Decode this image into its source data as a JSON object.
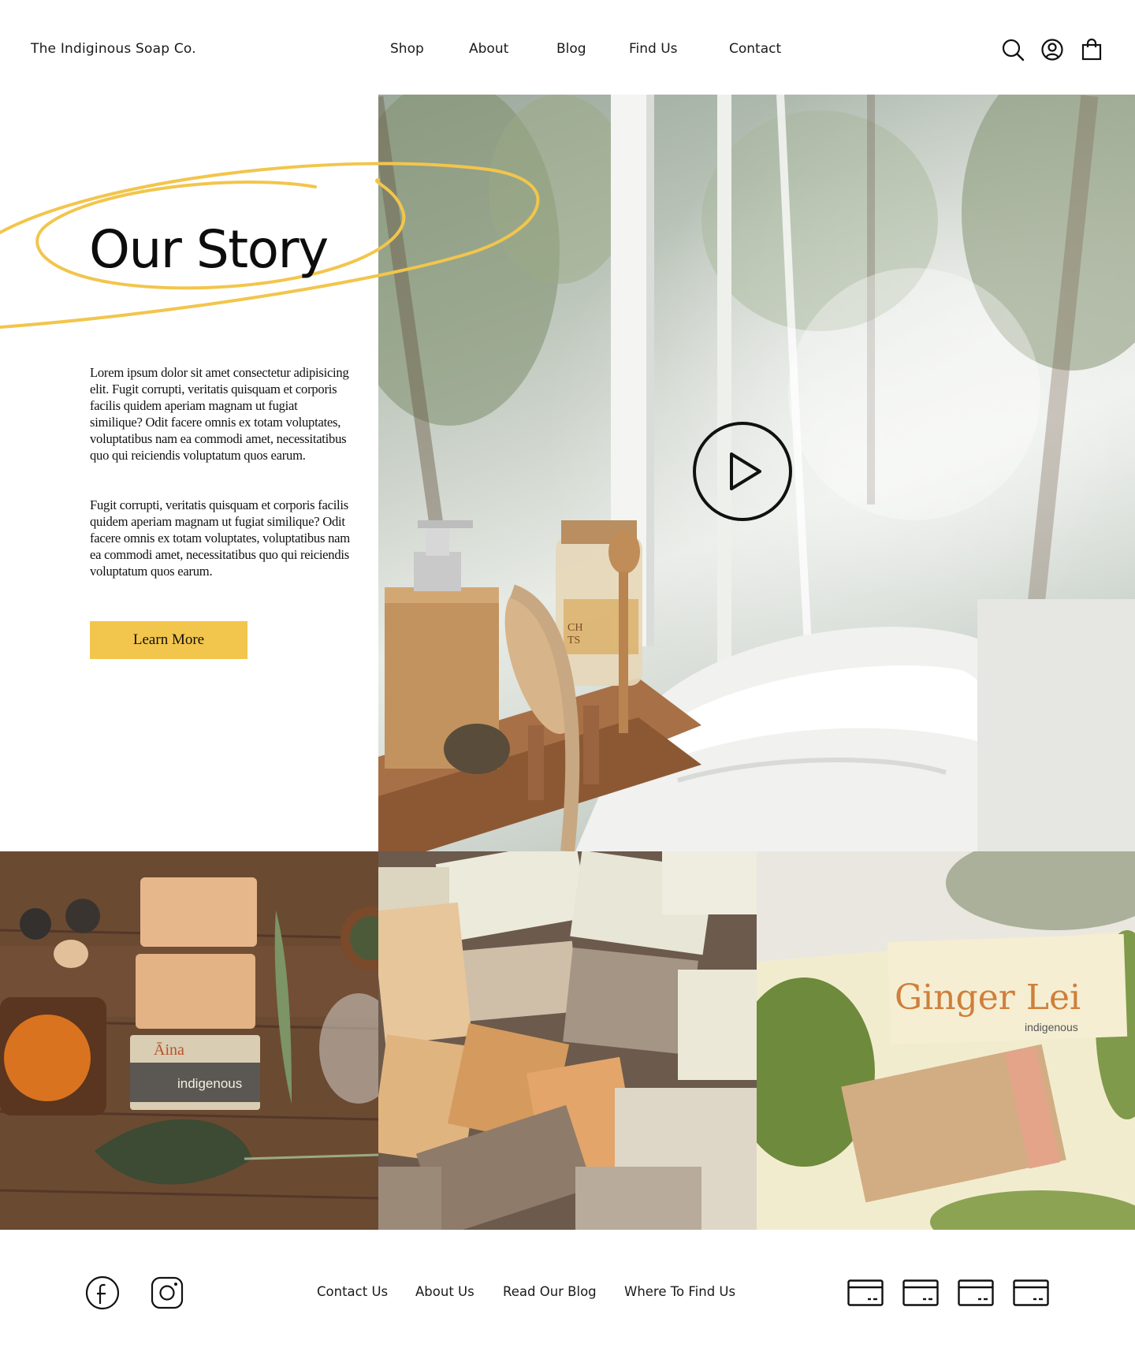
{
  "header": {
    "brand": "The Indiginous Soap Co.",
    "nav": [
      "Shop",
      "About",
      "Blog",
      "Find Us",
      "Contact"
    ],
    "icons": [
      "search-icon",
      "account-icon",
      "cart-icon"
    ]
  },
  "story": {
    "title": "Our Story",
    "paragraph_1": "Lorem ipsum dolor sit amet consectetur adipisicing elit. Fugit corrupti, veritatis quisquam et corporis facilis quidem aperiam magnam ut fugiat similique? Odit facere omnis ex totam voluptates, voluptatibus nam ea commodi amet, necessitatibus quo qui reiciendis  voluptatum quos earum.",
    "paragraph_2": "Fugit corrupti, veritatis quisquam et corporis facilis quidem aperiam magnam ut fugiat similique? Odit facere omnis ex totam voluptates, voluptatibus nam ea commodi amet, necessitatibus quo qui reiciendis  voluptatum quos earum.",
    "button_label": "Learn More",
    "accent_color": "#f2c54c"
  },
  "hero": {
    "play_icon": "play-icon",
    "bottle_label": "CH\nTS"
  },
  "gallery": {
    "tile_1": {
      "wrapper_top": "Āina",
      "wrapper_brand": "indigenous"
    },
    "tile_2": {},
    "tile_3": {
      "product_name": "Ginger Lei",
      "product_brand": "indigenous"
    }
  },
  "footer": {
    "social_icons": [
      "facebook-icon",
      "instagram-icon"
    ],
    "links": [
      "Contact Us",
      "About Us",
      "Read Our Blog",
      "Where To Find Us"
    ],
    "payment_icons": [
      "card-icon",
      "card-icon",
      "card-icon",
      "card-icon"
    ]
  }
}
